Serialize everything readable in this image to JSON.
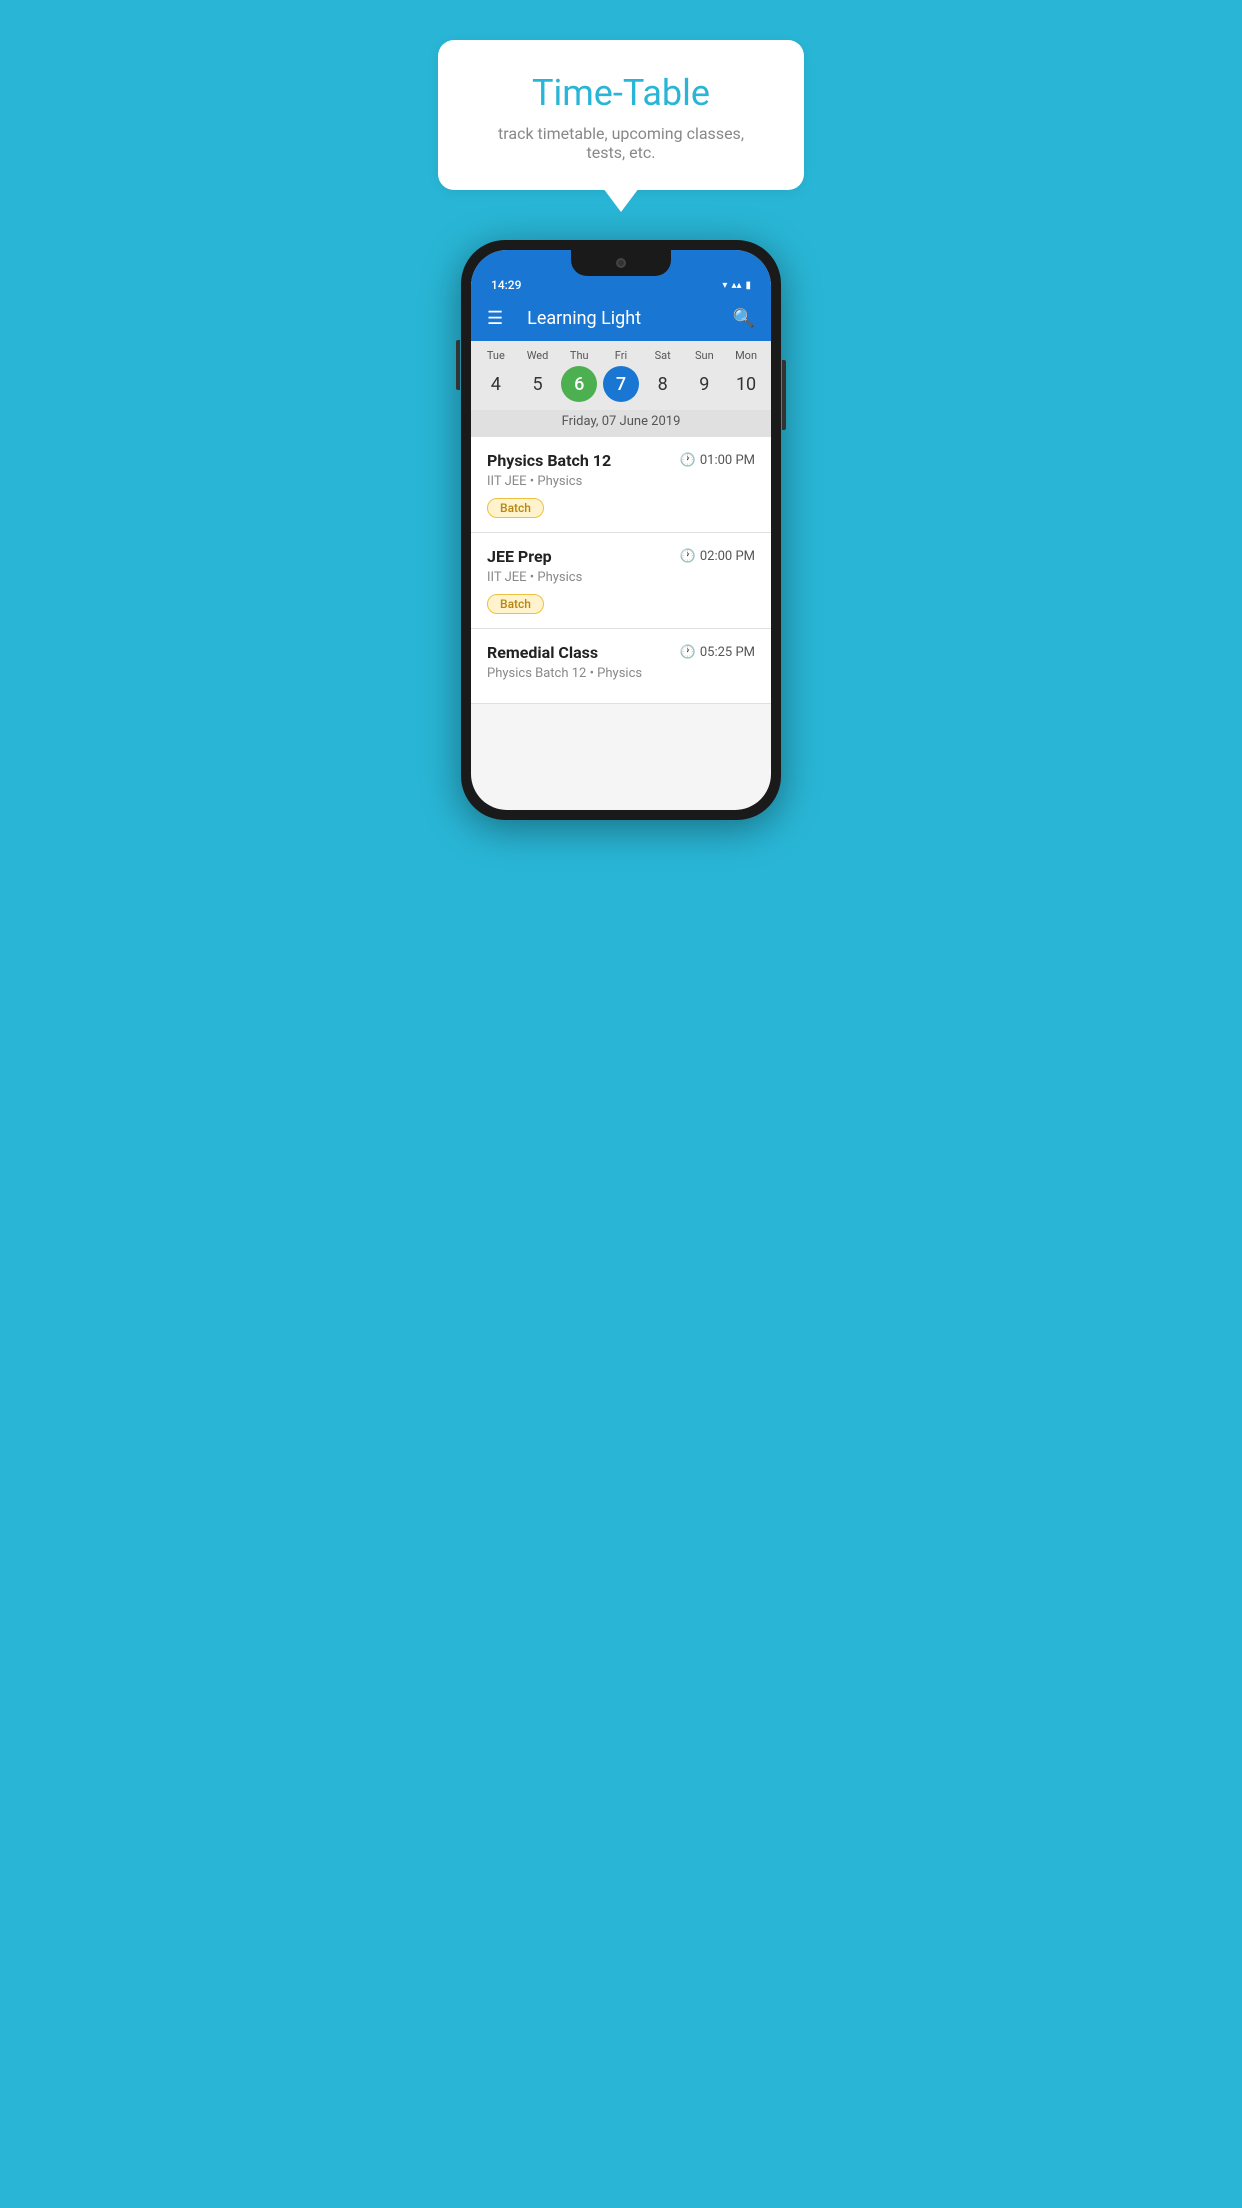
{
  "background_color": "#29B6D6",
  "speech_bubble": {
    "title": "Time-Table",
    "subtitle": "track timetable, upcoming classes, tests, etc."
  },
  "app_bar": {
    "title": "Learning Light"
  },
  "status_bar": {
    "time": "14:29"
  },
  "calendar": {
    "days": [
      {
        "label": "Tue",
        "num": "4"
      },
      {
        "label": "Wed",
        "num": "5"
      },
      {
        "label": "Thu",
        "num": "6",
        "state": "today"
      },
      {
        "label": "Fri",
        "num": "7",
        "state": "selected"
      },
      {
        "label": "Sat",
        "num": "8"
      },
      {
        "label": "Sun",
        "num": "9"
      },
      {
        "label": "Mon",
        "num": "10"
      }
    ],
    "selected_date": "Friday, 07 June 2019"
  },
  "schedule_items": [
    {
      "title": "Physics Batch 12",
      "time": "01:00 PM",
      "subtitle": "IIT JEE • Physics",
      "tag": "Batch"
    },
    {
      "title": "JEE Prep",
      "time": "02:00 PM",
      "subtitle": "IIT JEE • Physics",
      "tag": "Batch"
    },
    {
      "title": "Remedial Class",
      "time": "05:25 PM",
      "subtitle": "Physics Batch 12 • Physics",
      "tag": null
    }
  ],
  "icons": {
    "hamburger": "☰",
    "search": "🔍",
    "clock": "🕐",
    "wifi": "▾",
    "signal": "▴▴",
    "battery": "▮"
  }
}
